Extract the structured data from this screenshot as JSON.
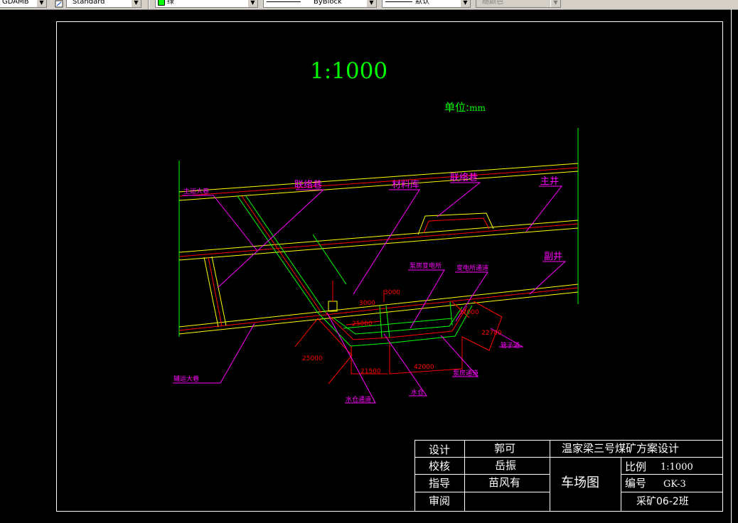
{
  "toolbar": {
    "text_style_partial": "GDAMB",
    "dim_style": "Standard",
    "color": "绿",
    "color_swatch": "#00ff00",
    "linetype": "ByBlock",
    "lineweight": "默认",
    "plot_style": "随颜色"
  },
  "drawing": {
    "scale": "1:1000",
    "unit": "单位:",
    "unit_suffix": "mm",
    "colors": {
      "roadway": "#ffff00",
      "centerline": "#ff0000",
      "green": "#00ff00",
      "labels": "#ff00ff",
      "dims": "#ff0000"
    },
    "labels": {
      "main_transport": "主运大巷",
      "link_roadway_1": "联络巷",
      "material_store": "材料库",
      "link_roadway_2": "联络巷",
      "main_shaft": "主井",
      "aux_shaft": "副井",
      "pump_substation": "泵房变电所",
      "substation_passage": "变电所通道",
      "pipe_shaft": "管子道",
      "transport_roadway": "辅运大巷",
      "sump_passage": "水仓通道",
      "sump": "水仓",
      "pump_passage": "泵房通道"
    },
    "dims": {
      "d1": "3000",
      "d2": "3000",
      "d3": "25000",
      "d4": "37000",
      "d5": "22700",
      "d6": "25000",
      "d7": "21500",
      "d8": "42000"
    }
  },
  "title_block": {
    "design_label": "设计",
    "design_name": "郭可",
    "check_label": "校核",
    "check_name": "岳振",
    "guide_label": "指导",
    "guide_name": "苗风有",
    "review_label": "审阅",
    "review_name": "",
    "project_title": "温家梁三号煤矿方案设计",
    "drawing_name": "车场图",
    "scale_label": "比例",
    "scale_value": "1:1000",
    "code_label": "编号",
    "code_value": "GK-3",
    "class_name": "采矿06-2班"
  }
}
